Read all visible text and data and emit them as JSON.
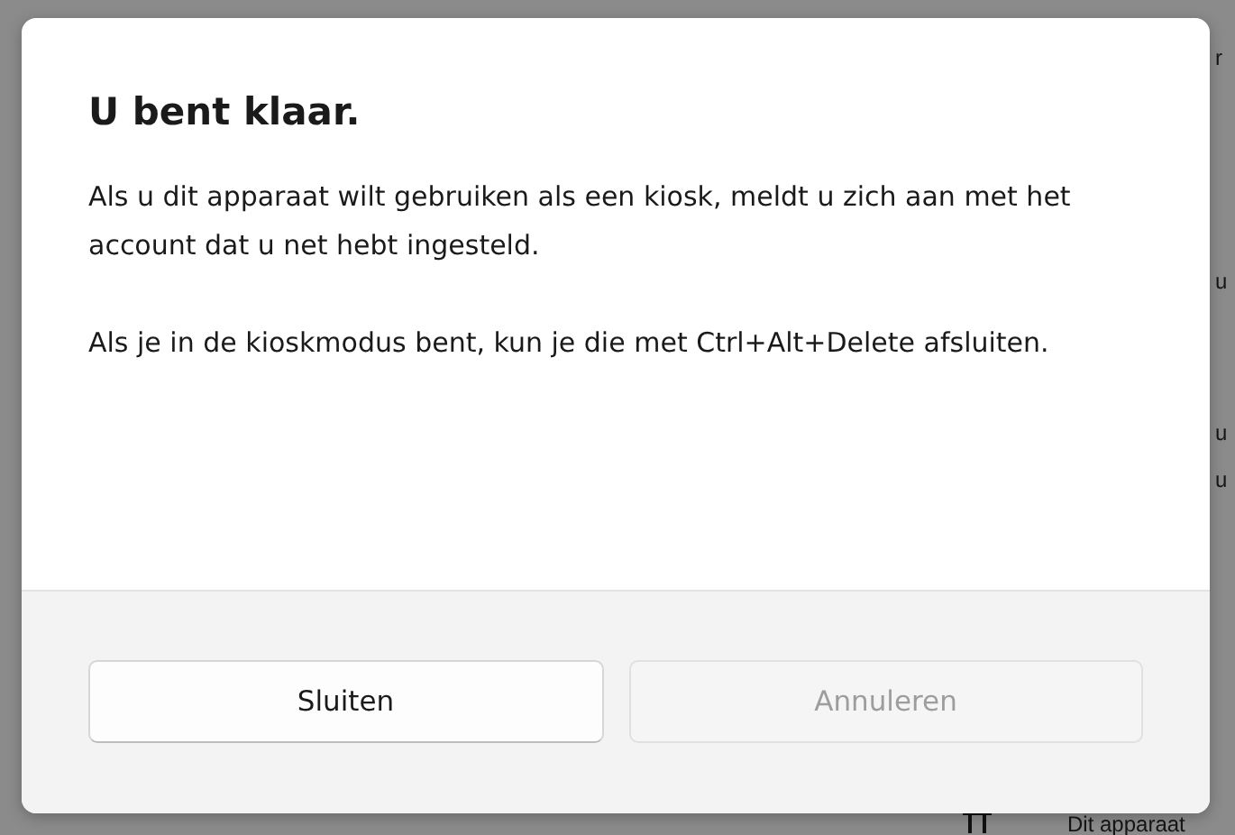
{
  "background": {
    "fragments": [
      "r",
      "u",
      "u",
      "u",
      "Dit apparaat"
    ]
  },
  "dialog": {
    "title": "U bent klaar.",
    "paragraphs": [
      "Als u dit apparaat wilt gebruiken als een kiosk, meldt u zich aan met het account dat u net hebt ingesteld.",
      "Als je in de kioskmodus bent, kun je die met Ctrl+Alt+Delete afsluiten."
    ],
    "buttons": [
      {
        "label": "Sluiten",
        "disabled": false
      },
      {
        "label": "Annuleren",
        "disabled": true
      }
    ]
  }
}
